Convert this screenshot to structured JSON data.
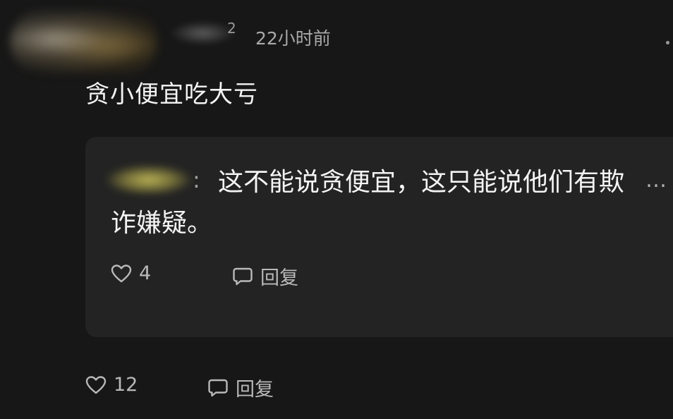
{
  "comment": {
    "username_suffix": "2",
    "timestamp": "22小时前",
    "text": "贪小便宜吃大亏",
    "likes": "12",
    "reply_label": "回复",
    "like_icon": "heart-icon",
    "reply_icon": "comment-bubble-icon"
  },
  "reply": {
    "separator": ":",
    "text": "这不能说贪便宜，这只能说他们有欺诈嫌疑。",
    "more_label": "…",
    "likes": "4",
    "reply_label": "回复",
    "like_icon": "heart-icon",
    "reply_icon": "comment-bubble-icon"
  },
  "colors": {
    "background": "#171717",
    "card": "#232323",
    "text": "#f4f4f4",
    "muted": "#a9a9a9"
  }
}
